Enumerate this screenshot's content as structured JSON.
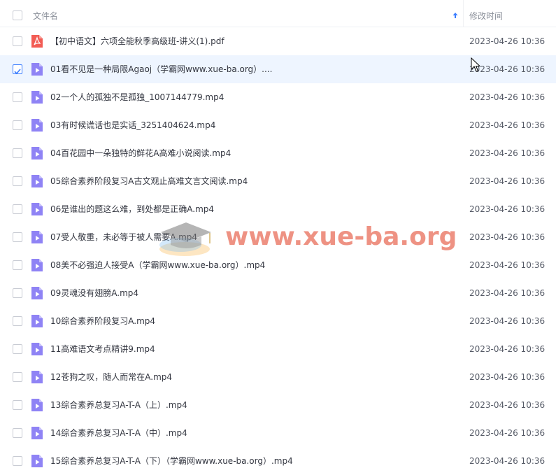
{
  "header": {
    "name_label": "文件名",
    "time_label": "修改时间"
  },
  "watermark": {
    "text": "www.xue-ba.org",
    "logo_icon": "graduation-cap-icon"
  },
  "colors": {
    "pdf_icon": "#f25c54",
    "video_icon": "#8f83f5",
    "selected_row": "#eef5ff",
    "checkbox_checked": "#3a7dff",
    "watermark": "#e86e5a"
  },
  "files": [
    {
      "name": "【初中语文】六项全能秋季高级班-讲义(1).pdf",
      "time": "2023-04-26 10:36",
      "type": "pdf",
      "selected": false
    },
    {
      "name": "01看不见是一种局限Agaoj（学霸网www.xue-ba.org）....",
      "time": "2023-04-26 10:36",
      "type": "video",
      "selected": true
    },
    {
      "name": "02一个人的孤独不是孤独_1007144779.mp4",
      "time": "2023-04-26 10:36",
      "type": "video",
      "selected": false
    },
    {
      "name": "03有时候谎话也是实话_3251404624.mp4",
      "time": "2023-04-26 10:36",
      "type": "video",
      "selected": false
    },
    {
      "name": "04百花园中一朵独特的鲜花A高难小说阅读.mp4",
      "time": "2023-04-26 10:36",
      "type": "video",
      "selected": false
    },
    {
      "name": "05综合素养阶段复习A古文观止高难文言文阅读.mp4",
      "time": "2023-04-26 10:36",
      "type": "video",
      "selected": false
    },
    {
      "name": "06是谁出的题这么难，到处都是正确A.mp4",
      "time": "2023-04-26 10:36",
      "type": "video",
      "selected": false
    },
    {
      "name": "07受人敬重，未必等于被人需要A.mp4",
      "time": "2023-04-26 10:36",
      "type": "video",
      "selected": false
    },
    {
      "name": "08美不必强迫人接受A（学霸网www.xue-ba.org）.mp4",
      "time": "2023-04-26 10:36",
      "type": "video",
      "selected": false
    },
    {
      "name": "09灵魂没有翅膀A.mp4",
      "time": "2023-04-26 10:36",
      "type": "video",
      "selected": false
    },
    {
      "name": "10综合素养阶段复习A.mp4",
      "time": "2023-04-26 10:36",
      "type": "video",
      "selected": false
    },
    {
      "name": "11高难语文考点精讲9.mp4",
      "time": "2023-04-26 10:36",
      "type": "video",
      "selected": false
    },
    {
      "name": "12苍狗之叹，随人而常在A.mp4",
      "time": "2023-04-26 10:36",
      "type": "video",
      "selected": false
    },
    {
      "name": "13综合素养总复习A-T-A（上）.mp4",
      "time": "2023-04-26 10:36",
      "type": "video",
      "selected": false
    },
    {
      "name": "14综合素养总复习A-T-A（中）.mp4",
      "time": "2023-04-26 10:36",
      "type": "video",
      "selected": false
    },
    {
      "name": "15综合素养总复习A-T-A（下）（学霸网www.xue-ba.org）.mp4",
      "time": "2023-04-26 10:36",
      "type": "video",
      "selected": false
    }
  ]
}
